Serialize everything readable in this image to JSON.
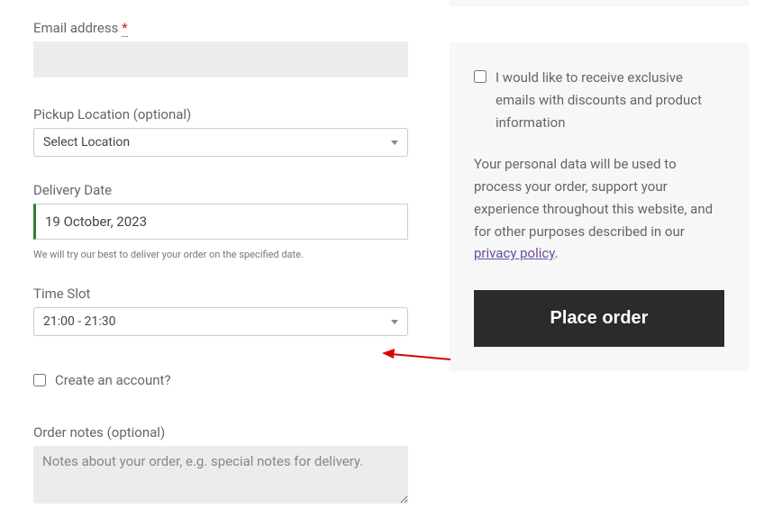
{
  "form": {
    "email": {
      "label": "Email address",
      "required_marker": "*"
    },
    "pickup": {
      "label": "Pickup Location (optional)",
      "selected": "Select Location"
    },
    "delivery_date": {
      "label": "Delivery Date",
      "value": "19 October, 2023",
      "hint": "We will try our best to deliver your order on the specified date."
    },
    "time_slot": {
      "label": "Time Slot",
      "selected": "21:00 - 21:30"
    },
    "create_account": {
      "label": "Create an account?"
    },
    "order_notes": {
      "label": "Order notes (optional)",
      "placeholder": "Notes about your order, e.g. special notes for delivery."
    }
  },
  "panel": {
    "opt_in": "I would like to receive exclusive emails with discounts and product information",
    "privacy_text": "Your personal data will be used to process your order, support your experience throughout this website, and for other purposes described in our ",
    "privacy_link": "privacy policy",
    "place_order": "Place order"
  },
  "colors": {
    "annotation_arrow": "#dd0000"
  }
}
